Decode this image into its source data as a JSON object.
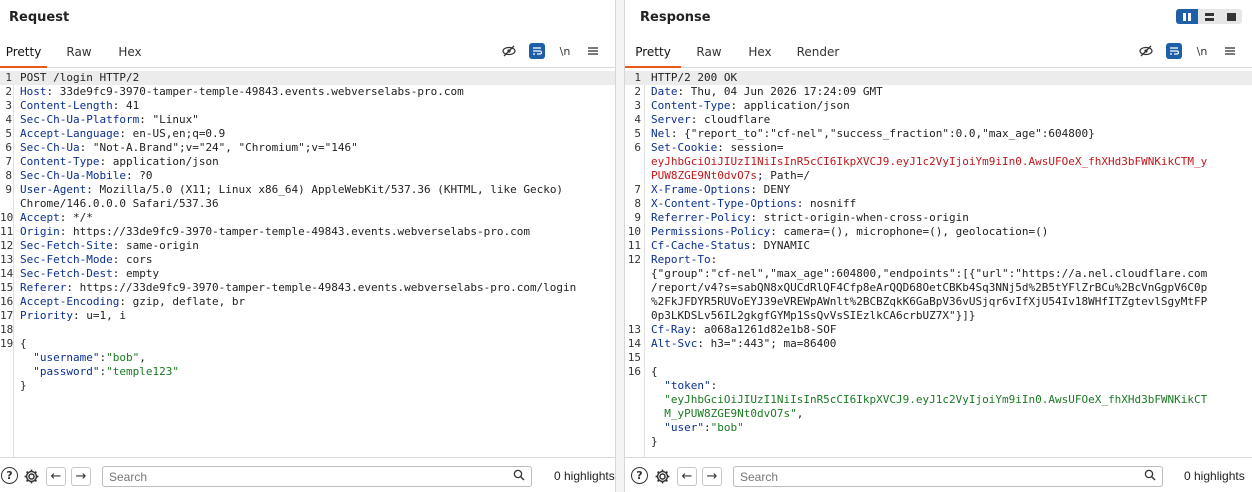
{
  "request": {
    "title": "Request",
    "tabs": [
      "Pretty",
      "Raw",
      "Hex"
    ],
    "active_tab": "Pretty",
    "tools": {
      "newline_label": "\\n"
    },
    "lines": [
      {
        "n": "1",
        "segs": [
          {
            "t": "POST /login HTTP/2",
            "c": ""
          }
        ]
      },
      {
        "n": "2",
        "segs": [
          {
            "t": "Host",
            "c": "k"
          },
          {
            "t": ": 33de9fc9-3970-tamper-temple-49843.events.webverselabs-pro.com",
            "c": ""
          }
        ]
      },
      {
        "n": "3",
        "segs": [
          {
            "t": "Content-Length",
            "c": "k"
          },
          {
            "t": ": 41",
            "c": ""
          }
        ]
      },
      {
        "n": "4",
        "segs": [
          {
            "t": "Sec-Ch-Ua-Platform",
            "c": "k"
          },
          {
            "t": ": \"Linux\"",
            "c": ""
          }
        ]
      },
      {
        "n": "5",
        "segs": [
          {
            "t": "Accept-Language",
            "c": "k"
          },
          {
            "t": ": en-US,en;q=0.9",
            "c": ""
          }
        ]
      },
      {
        "n": "6",
        "segs": [
          {
            "t": "Sec-Ch-Ua",
            "c": "k"
          },
          {
            "t": ": \"Not-A.Brand\";v=\"24\", \"Chromium\";v=\"146\"",
            "c": ""
          }
        ]
      },
      {
        "n": "7",
        "segs": [
          {
            "t": "Content-Type",
            "c": "k"
          },
          {
            "t": ": application/json",
            "c": ""
          }
        ]
      },
      {
        "n": "8",
        "segs": [
          {
            "t": "Sec-Ch-Ua-Mobile",
            "c": "k"
          },
          {
            "t": ": ?0",
            "c": ""
          }
        ]
      },
      {
        "n": "9",
        "segs": [
          {
            "t": "User-Agent",
            "c": "k"
          },
          {
            "t": ": Mozilla/5.0 (X11; Linux x86_64) AppleWebKit/537.36 (KHTML, like Gecko)",
            "c": ""
          }
        ]
      },
      {
        "n": "",
        "segs": [
          {
            "t": "Chrome/146.0.0.0 Safari/537.36",
            "c": ""
          }
        ]
      },
      {
        "n": "10",
        "segs": [
          {
            "t": "Accept",
            "c": "k"
          },
          {
            "t": ": */*",
            "c": ""
          }
        ]
      },
      {
        "n": "11",
        "segs": [
          {
            "t": "Origin",
            "c": "k"
          },
          {
            "t": ": https://33de9fc9-3970-tamper-temple-49843.events.webverselabs-pro.com",
            "c": ""
          }
        ]
      },
      {
        "n": "12",
        "segs": [
          {
            "t": "Sec-Fetch-Site",
            "c": "k"
          },
          {
            "t": ": same-origin",
            "c": ""
          }
        ]
      },
      {
        "n": "13",
        "segs": [
          {
            "t": "Sec-Fetch-Mode",
            "c": "k"
          },
          {
            "t": ": cors",
            "c": ""
          }
        ]
      },
      {
        "n": "14",
        "segs": [
          {
            "t": "Sec-Fetch-Dest",
            "c": "k"
          },
          {
            "t": ": empty",
            "c": ""
          }
        ]
      },
      {
        "n": "15",
        "segs": [
          {
            "t": "Referer",
            "c": "k"
          },
          {
            "t": ": https://33de9fc9-3970-tamper-temple-49843.events.webverselabs-pro.com/login",
            "c": ""
          }
        ]
      },
      {
        "n": "16",
        "segs": [
          {
            "t": "Accept-Encoding",
            "c": "k"
          },
          {
            "t": ": gzip, deflate, br",
            "c": ""
          }
        ]
      },
      {
        "n": "17",
        "segs": [
          {
            "t": "Priority",
            "c": "k"
          },
          {
            "t": ": u=1, i",
            "c": ""
          }
        ]
      },
      {
        "n": "18",
        "segs": []
      },
      {
        "n": "19",
        "segs": [
          {
            "t": "{",
            "c": ""
          }
        ]
      },
      {
        "n": "",
        "segs": [
          {
            "t": "  \"username\"",
            "c": "k"
          },
          {
            "t": ":",
            "c": ""
          },
          {
            "t": "\"bob\"",
            "c": "str"
          },
          {
            "t": ",",
            "c": ""
          }
        ]
      },
      {
        "n": "",
        "segs": [
          {
            "t": "  \"password\"",
            "c": "k"
          },
          {
            "t": ":",
            "c": ""
          },
          {
            "t": "\"temple123\"",
            "c": "str"
          }
        ]
      },
      {
        "n": "",
        "segs": [
          {
            "t": "}",
            "c": ""
          }
        ]
      }
    ],
    "footer": {
      "search_placeholder": "Search",
      "highlights": "0 highlights"
    }
  },
  "response": {
    "title": "Response",
    "tabs": [
      "Pretty",
      "Raw",
      "Hex",
      "Render"
    ],
    "active_tab": "Pretty",
    "tools": {
      "newline_label": "\\n"
    },
    "lines": [
      {
        "n": "1",
        "segs": [
          {
            "t": "HTTP/2 200 OK",
            "c": ""
          }
        ]
      },
      {
        "n": "2",
        "segs": [
          {
            "t": "Date",
            "c": "k"
          },
          {
            "t": ": Thu, 04 Jun 2026 17:24:09 GMT",
            "c": ""
          }
        ]
      },
      {
        "n": "3",
        "segs": [
          {
            "t": "Content-Type",
            "c": "k"
          },
          {
            "t": ": application/json",
            "c": ""
          }
        ]
      },
      {
        "n": "4",
        "segs": [
          {
            "t": "Server",
            "c": "k"
          },
          {
            "t": ": cloudflare",
            "c": ""
          }
        ]
      },
      {
        "n": "5",
        "segs": [
          {
            "t": "Nel",
            "c": "k"
          },
          {
            "t": ": {\"report_to\":\"cf-nel\",\"success_fraction\":0.0,\"max_age\":604800}",
            "c": ""
          }
        ]
      },
      {
        "n": "6",
        "segs": [
          {
            "t": "Set-Cookie",
            "c": "k"
          },
          {
            "t": ": session=",
            "c": ""
          }
        ]
      },
      {
        "n": "",
        "segs": [
          {
            "t": "eyJhbGciOiJIUzI1NiIsInR5cCI6IkpXVCJ9.eyJ1c2VyIjoiYm9iIn0.AwsUFOeX_fhXHd3bFWNKikCTM_y",
            "c": "err"
          }
        ]
      },
      {
        "n": "",
        "segs": [
          {
            "t": "PUW8ZGE9Nt0dvO7s",
            "c": "err"
          },
          {
            "t": "; Path=/",
            "c": ""
          }
        ]
      },
      {
        "n": "7",
        "segs": [
          {
            "t": "X-Frame-Options",
            "c": "k"
          },
          {
            "t": ": DENY",
            "c": ""
          }
        ]
      },
      {
        "n": "8",
        "segs": [
          {
            "t": "X-Content-Type-Options",
            "c": "k"
          },
          {
            "t": ": nosniff",
            "c": ""
          }
        ]
      },
      {
        "n": "9",
        "segs": [
          {
            "t": "Referrer-Policy",
            "c": "k"
          },
          {
            "t": ": strict-origin-when-cross-origin",
            "c": ""
          }
        ]
      },
      {
        "n": "10",
        "segs": [
          {
            "t": "Permissions-Policy",
            "c": "k"
          },
          {
            "t": ": camera=(), microphone=(), geolocation=()",
            "c": ""
          }
        ]
      },
      {
        "n": "11",
        "segs": [
          {
            "t": "Cf-Cache-Status",
            "c": "k"
          },
          {
            "t": ": DYNAMIC",
            "c": ""
          }
        ]
      },
      {
        "n": "12",
        "segs": [
          {
            "t": "Report-To",
            "c": "k"
          },
          {
            "t": ":",
            "c": ""
          }
        ]
      },
      {
        "n": "",
        "segs": [
          {
            "t": "{\"group\":\"cf-nel\",\"max_age\":604800,\"endpoints\":[{\"url\":\"https://a.nel.cloudflare.com",
            "c": ""
          }
        ]
      },
      {
        "n": "",
        "segs": [
          {
            "t": "/report/v4?s=sabQN8xQUCdRlQF4Cfp8eArQQD68OetCBKb4Sq3NNj5d%2B5tYFlZrBCu%2BcVnGgpV6C0p",
            "c": ""
          }
        ]
      },
      {
        "n": "",
        "segs": [
          {
            "t": "%2FkJFDYR5RUVoEYJ39eVREWpAWnlt%2BCBZqkK6GaBpV36vUSjqr6vIfXjU54Iv18WHfITZgtevlSgyMtFP",
            "c": ""
          }
        ]
      },
      {
        "n": "",
        "segs": [
          {
            "t": "0p3LKDSLv56IL2gkgfGYMp1SsQvVsSIEzlkCA6crbUZ7X\"}]}",
            "c": ""
          }
        ]
      },
      {
        "n": "13",
        "segs": [
          {
            "t": "Cf-Ray",
            "c": "k"
          },
          {
            "t": ": a068a1261d82e1b8-SOF",
            "c": ""
          }
        ]
      },
      {
        "n": "14",
        "segs": [
          {
            "t": "Alt-Svc",
            "c": "k"
          },
          {
            "t": ": h3=\":443\"; ma=86400",
            "c": ""
          }
        ]
      },
      {
        "n": "15",
        "segs": []
      },
      {
        "n": "16",
        "segs": [
          {
            "t": "{",
            "c": ""
          }
        ]
      },
      {
        "n": "",
        "segs": [
          {
            "t": "  \"token\"",
            "c": "k"
          },
          {
            "t": ":",
            "c": ""
          }
        ]
      },
      {
        "n": "",
        "segs": [
          {
            "t": "  \"eyJhbGciOiJIUzI1NiIsInR5cCI6IkpXVCJ9.eyJ1c2VyIjoiYm9iIn0.AwsUFOeX_fhXHd3bFWNKikCT",
            "c": "str"
          }
        ]
      },
      {
        "n": "",
        "segs": [
          {
            "t": "  M_yPUW8ZGE9Nt0dvO7s\"",
            "c": "str"
          },
          {
            "t": ",",
            "c": ""
          }
        ]
      },
      {
        "n": "",
        "segs": [
          {
            "t": "  \"user\"",
            "c": "k"
          },
          {
            "t": ":",
            "c": ""
          },
          {
            "t": "\"bob\"",
            "c": "str"
          }
        ]
      },
      {
        "n": "",
        "segs": [
          {
            "t": "}",
            "c": ""
          }
        ]
      }
    ],
    "footer": {
      "search_placeholder": "Search",
      "highlights": "0 highlights"
    }
  }
}
